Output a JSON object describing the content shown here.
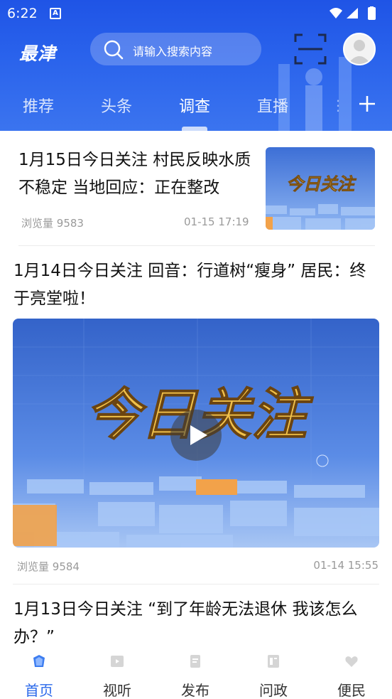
{
  "status_bar": {
    "time": "6:22",
    "notification_letter": "A"
  },
  "header": {
    "logo": "最津",
    "search_placeholder": "请输入搜索内容",
    "icons": {
      "search": "search-icon",
      "scan": "scan-icon",
      "avatar": "avatar-icon"
    },
    "colors": {
      "header_bg": "#2a63ec",
      "accent": "#2a68ea"
    }
  },
  "tabs": [
    {
      "label": "推荐",
      "active": false
    },
    {
      "label": "头条",
      "active": false
    },
    {
      "label": "调查",
      "active": true
    },
    {
      "label": "直播",
      "active": false
    }
  ],
  "feed": [
    {
      "title": "1月15日今日关注  村民反映水质不稳定 当地回应：正在整改",
      "views_label": "浏览量",
      "views": "9583",
      "date": "01-15 17:19",
      "thumb_text": "今日关注"
    },
    {
      "title": "1月14日今日关注  回音：行道树“瘦身” 居民：终于亮堂啦！",
      "views_label": "浏览量",
      "views": "9584",
      "date": "01-14 15:55",
      "video_text": "今日关注"
    },
    {
      "title": "1月13日今日关注  “到了年龄无法退休 我该怎么办？”"
    }
  ],
  "bottom_nav": [
    {
      "label": "首页",
      "icon": "home-icon",
      "active": true
    },
    {
      "label": "视听",
      "icon": "video-icon",
      "active": false
    },
    {
      "label": "发布",
      "icon": "publish-icon",
      "active": false
    },
    {
      "label": "问政",
      "icon": "inquiry-icon",
      "active": false
    },
    {
      "label": "便民",
      "icon": "service-icon",
      "active": false
    }
  ]
}
